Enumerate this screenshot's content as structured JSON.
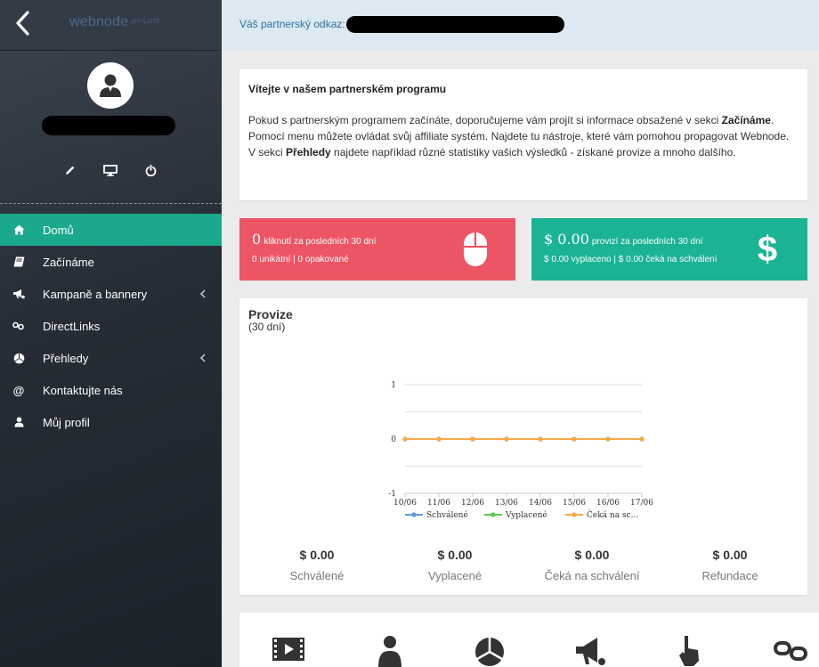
{
  "header": {
    "logo_text": "webnode",
    "logo_badge": "AFFILIATE"
  },
  "referral": {
    "label": "Váš partnerský odkaz:"
  },
  "sidebar": {
    "items": [
      {
        "label": "Domů",
        "icon": "home-icon",
        "active": true
      },
      {
        "label": "Začínáme",
        "icon": "book-icon"
      },
      {
        "label": "Kampaně a bannery",
        "icon": "megaphone-icon",
        "has_submenu": true
      },
      {
        "label": "DirectLinks",
        "icon": "link-icon"
      },
      {
        "label": "Přehledy",
        "icon": "pie-chart-icon",
        "has_submenu": true
      },
      {
        "label": "Kontaktujte nás",
        "icon": "at-icon"
      },
      {
        "label": "Můj profil",
        "icon": "user-icon"
      }
    ]
  },
  "welcome": {
    "title": "Vítejte v našem partnerském programu",
    "p1_pre": "Pokud s partnerským programem začínáte, doporučujeme vám projít si informace obsažené v sekci ",
    "p1_bold": "Začínáme",
    "p1_post": ".",
    "p2": "Pomocí menu můžete ovládat svůj affiliate systém. Najdete tu nástroje, které vám pomohou propagovat Webnode.",
    "p3_pre": "V sekci ",
    "p3_bold": "Přehledy",
    "p3_post": " najdete například různé statistiky vašich výsledků - získané provize a mnoho dalšího."
  },
  "stats": {
    "clicks": {
      "value": "0",
      "label": "kliknutí za posledních 30 dní",
      "sub": "0 unikátní | 0 opakované",
      "color": "#ed5565",
      "icon": "mouse-icon"
    },
    "commissions": {
      "value": "$ 0.00",
      "label": "provizí za posledních 30 dní",
      "sub": "$ 0.00 vyplaceno | $ 0.00 čeká na schválení",
      "color": "#1ab394",
      "icon": "dollar-icon"
    }
  },
  "provize": {
    "title": "Provize",
    "subtitle": "(30 dní)",
    "totals": [
      {
        "value": "$ 0.00",
        "label": "Schválené"
      },
      {
        "value": "$ 0.00",
        "label": "Vyplacené"
      },
      {
        "value": "$ 0.00",
        "label": "Čeká na schválení"
      },
      {
        "value": "$ 0.00",
        "label": "Refundace"
      }
    ]
  },
  "chart_data": {
    "type": "line",
    "title": "",
    "xlabel": "",
    "ylabel": "",
    "x": [
      "10/06",
      "11/06",
      "12/06",
      "13/06",
      "14/06",
      "15/06",
      "16/06",
      "17/06"
    ],
    "y_ticks": [
      "1",
      "0",
      "-1"
    ],
    "ylim": [
      -1,
      1
    ],
    "grid": true,
    "legend_position": "bottom",
    "legend_labels": [
      "Schválené",
      "Vyplacené",
      "Čeká na sc..."
    ],
    "series": [
      {
        "name": "Schválené",
        "color": "#5b9bd5",
        "values": [
          0,
          0,
          0,
          0,
          0,
          0,
          0,
          0
        ]
      },
      {
        "name": "Vyplacené",
        "color": "#57c84d",
        "values": [
          0,
          0,
          0,
          0,
          0,
          0,
          0,
          0
        ]
      },
      {
        "name": "Čeká na schválení",
        "color": "#f5a94b",
        "values": [
          0,
          0,
          0,
          0,
          0,
          0,
          0,
          0
        ]
      }
    ]
  },
  "tools": {
    "icons": [
      "film-icon",
      "user-icon",
      "pie-chart-icon",
      "megaphone-icon",
      "pointer-icon",
      "link-icon"
    ]
  }
}
